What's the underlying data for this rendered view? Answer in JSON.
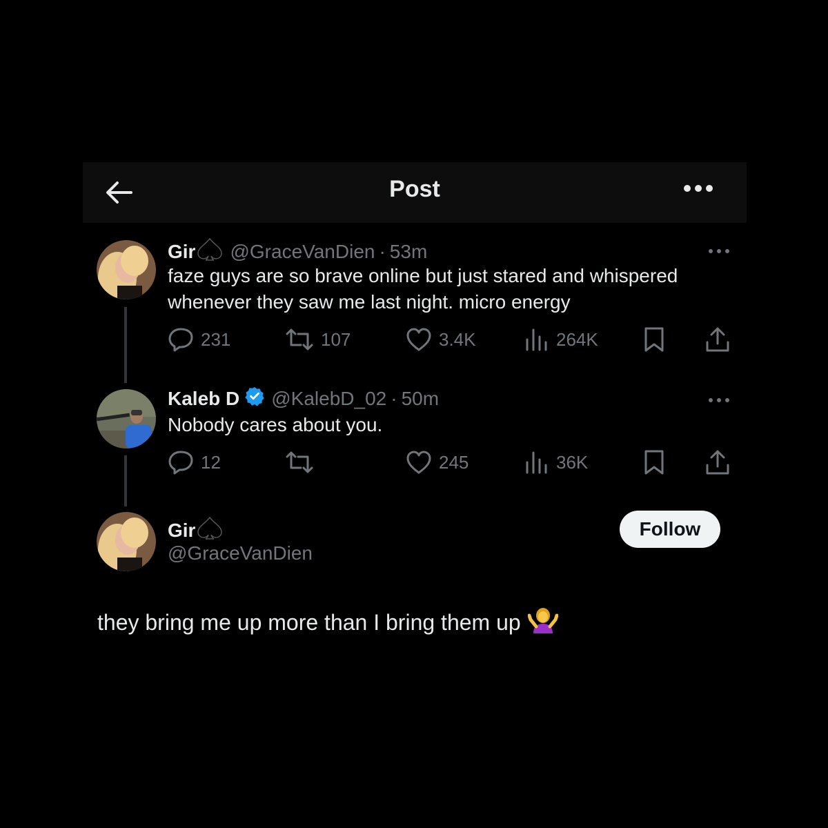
{
  "header": {
    "title": "Post"
  },
  "posts": [
    {
      "name": "Gir",
      "handle": "@GraceVanDien",
      "time": "53m",
      "text": "faze guys are so brave online but just stared and whispered whenever they saw me last night. micro energy",
      "replies": "231",
      "reposts": "107",
      "likes": "3.4K",
      "views": "264K"
    },
    {
      "name": "Kaleb D",
      "handle": "@KalebD_02",
      "time": "50m",
      "text": "Nobody cares about you.",
      "replies": "12",
      "reposts": "",
      "likes": "245",
      "views": "36K"
    }
  ],
  "main_post": {
    "name": "Gir",
    "handle": "@GraceVanDien",
    "text": "they bring me up more than I bring them up",
    "follow_label": "Follow"
  },
  "colors": {
    "background": "#000000",
    "muted": "#71767b",
    "verified": "#1d9bf0",
    "follow_bg": "#eff3f4"
  }
}
